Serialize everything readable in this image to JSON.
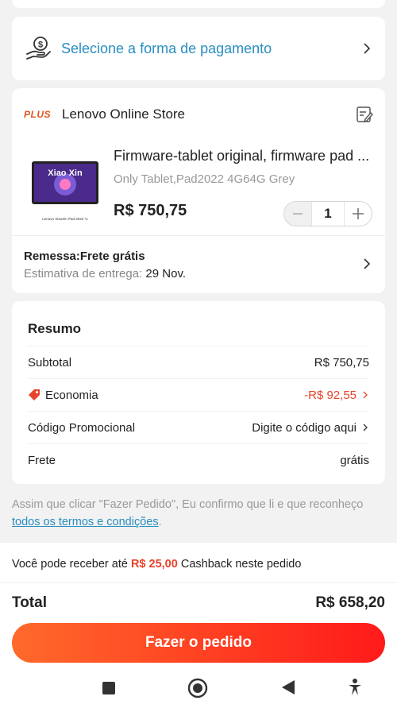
{
  "payment": {
    "label": "Selecione a forma de pagamento",
    "icon": "hand-coin-icon"
  },
  "store": {
    "badge": "PLUS",
    "name": "Lenovo Online Store",
    "product": {
      "title": "Firmware-tablet original, firmware pad ...",
      "variant": "Only Tablet,Pad2022 4G64G Grey",
      "price": "R$ 750,75",
      "quantity": "1",
      "thumb_brand": "Xiao Xin",
      "thumb_caption": "Lenovo XiaoXin Pad 2022 *1"
    },
    "shipping": {
      "title": "Remessa:Frete grátis",
      "estimate_label": "Estimativa de entrega: ",
      "estimate_date": "29 Nov."
    }
  },
  "summary": {
    "title": "Resumo",
    "rows": [
      {
        "label": "Subtotal",
        "value": "R$ 750,75"
      },
      {
        "label": "Economia",
        "value": "-R$ 92,55"
      },
      {
        "label": "Código Promocional",
        "value": "Digite o código aqui"
      },
      {
        "label": "Frete",
        "value": "grátis"
      }
    ]
  },
  "terms": {
    "text": "Assim que clicar \"Fazer Pedido\", Eu confirmo que li e que reconheço ",
    "link": "todos os termos e condições",
    "end": "."
  },
  "cashback": {
    "prefix": "Você pode receber até ",
    "amount": "R$ 25,00",
    "suffix": " Cashback neste pedido"
  },
  "total": {
    "label": "Total",
    "value": "R$ 658,20"
  },
  "order_button": "Fazer o pedido",
  "colors": {
    "accent_red": "#e8432b",
    "link_blue": "#2a8ec0",
    "button_start": "#ff6a2b",
    "button_end": "#ff1a1a"
  },
  "navbar": {
    "icons": [
      "recent-apps-icon",
      "home-icon",
      "back-icon",
      "accessibility-icon"
    ]
  }
}
